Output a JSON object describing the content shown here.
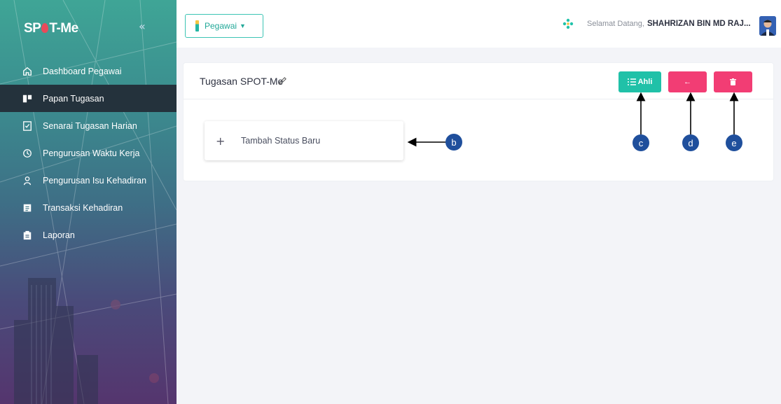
{
  "app": {
    "logo_text_before": "SP",
    "logo_text_after": "T-Me"
  },
  "sidebar": {
    "collapse_glyph": "«",
    "items": [
      {
        "label": "Dashboard Pegawai",
        "icon": "home-icon",
        "active": false
      },
      {
        "label": "Papan Tugasan",
        "icon": "board-icon",
        "active": true
      },
      {
        "label": "Senarai Tugasan Harian",
        "icon": "checklist-icon",
        "active": false
      },
      {
        "label": "Pengurusan Waktu Kerja",
        "icon": "clock-history-icon",
        "active": false
      },
      {
        "label": "Pengurusan Isu Kehadiran",
        "icon": "user-icon",
        "active": false
      },
      {
        "label": "Transaksi Kehadiran",
        "icon": "list-icon",
        "active": false
      },
      {
        "label": "Laporan",
        "icon": "report-icon",
        "active": false
      }
    ]
  },
  "topbar": {
    "role_label": "Pegawai",
    "welcome_prefix": "Selamat Datang,",
    "user_name": "SHAHRIZAN BIN MD RAJ..."
  },
  "card": {
    "title": "Tugasan SPOT-Me",
    "ahli_label": "Ahli",
    "back_glyph": "←",
    "delete_glyph": "🗑",
    "add_status_plus": "+",
    "add_status_label": "Tambah Status Baru"
  },
  "callouts": {
    "b": "b",
    "c": "c",
    "d": "d",
    "e": "e"
  },
  "colors": {
    "teal": "#20c1a8",
    "pink": "#f23d74",
    "callout": "#1f4f9c",
    "active_nav": "#24323c"
  }
}
